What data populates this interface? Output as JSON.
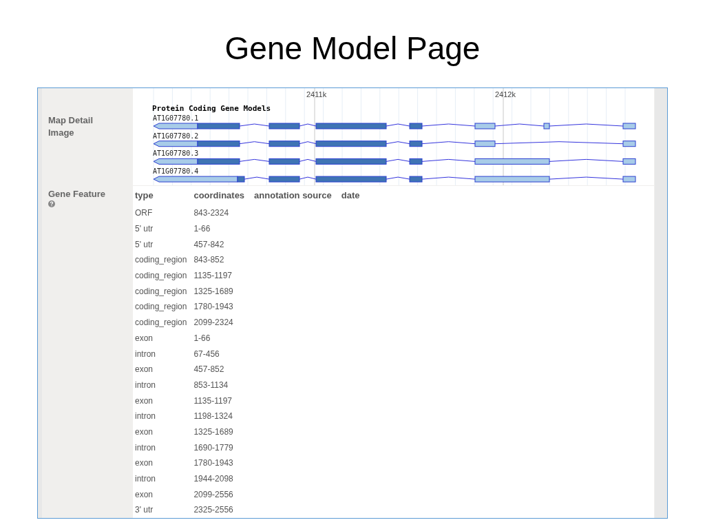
{
  "slide_title": "Gene Model Page",
  "map_detail": {
    "label": "Map Detail Image",
    "ticks": [
      "2411k",
      "2412k"
    ],
    "track_title": "Protein Coding Gene Models",
    "transcripts": [
      {
        "name": "AT1G07780.1"
      },
      {
        "name": "AT1G07780.2"
      },
      {
        "name": "AT1G07780.3"
      },
      {
        "name": "AT1G07780.4"
      }
    ]
  },
  "gene_feature": {
    "label": "Gene Feature",
    "columns": [
      "type",
      "coordinates",
      "annotation source",
      "date"
    ],
    "rows": [
      [
        "ORF",
        "843-2324"
      ],
      [
        "5' utr",
        "1-66"
      ],
      [
        "5' utr",
        "457-842"
      ],
      [
        "coding_region",
        "843-852"
      ],
      [
        "coding_region",
        "1135-1197"
      ],
      [
        "coding_region",
        "1325-1689"
      ],
      [
        "coding_region",
        "1780-1943"
      ],
      [
        "coding_region",
        "2099-2324"
      ],
      [
        "exon",
        "1-66"
      ],
      [
        "intron",
        "67-456"
      ],
      [
        "exon",
        "457-852"
      ],
      [
        "intron",
        "853-1134"
      ],
      [
        "exon",
        "1135-1197"
      ],
      [
        "intron",
        "1198-1324"
      ],
      [
        "exon",
        "1325-1689"
      ],
      [
        "intron",
        "1690-1779"
      ],
      [
        "exon",
        "1780-1943"
      ],
      [
        "intron",
        "1944-2098"
      ],
      [
        "exon",
        "2099-2556"
      ],
      [
        "3' utr",
        "2325-2556"
      ]
    ]
  }
}
